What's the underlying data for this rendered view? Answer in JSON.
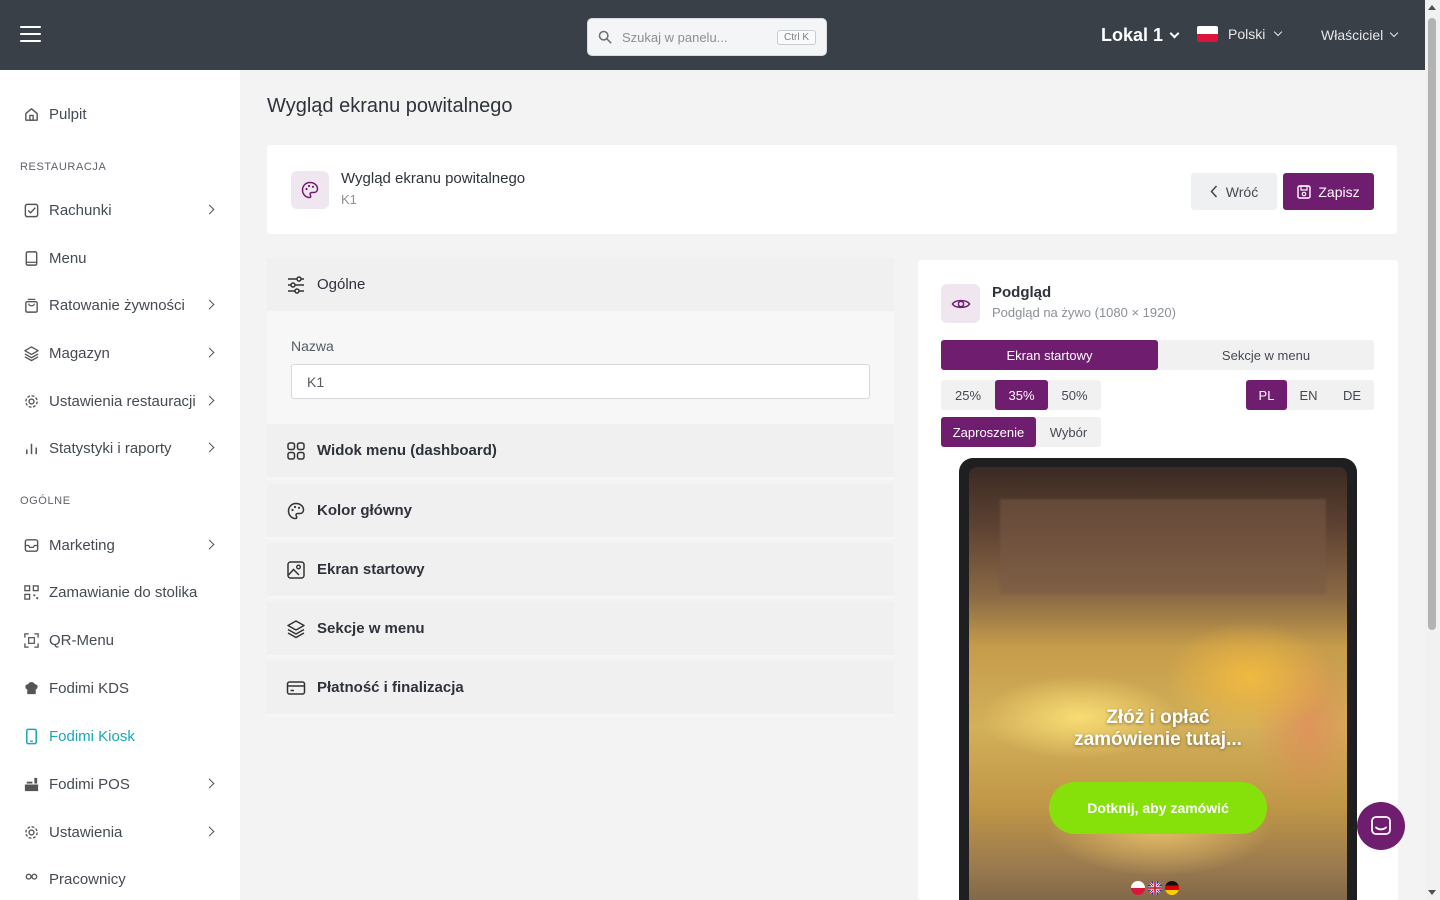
{
  "topbar": {
    "search_placeholder": "Szukaj w panelu...",
    "search_shortcut": "Ctrl K",
    "location": "Lokal 1",
    "language": "Polski",
    "role": "Właściciel"
  },
  "sidebar": {
    "pulpit": "Pulpit",
    "section_restauracja": "RESTAURACJA",
    "rachunki": "Rachunki",
    "menu": "Menu",
    "ratowanie": "Ratowanie żywności",
    "magazyn": "Magazyn",
    "ustawienia_restauracji": "Ustawienia restauracji",
    "statystyki": "Statystyki i raporty",
    "section_ogolne": "OGÓLNE",
    "marketing": "Marketing",
    "zamawianie": "Zamawianie do stolika",
    "qrmenu": "QR-Menu",
    "kds": "Fodimi KDS",
    "kiosk": "Fodimi Kiosk",
    "pos": "Fodimi POS",
    "ustawienia": "Ustawienia",
    "pracownicy": "Pracownicy"
  },
  "page": {
    "title": "Wygląd ekranu powitalnego",
    "card_title": "Wygląd ekranu powitalnego",
    "card_subtitle": "K1",
    "back_label": "Wróć",
    "save_label": "Zapisz"
  },
  "settings": {
    "general": "Ogólne",
    "name_label": "Nazwa",
    "name_value": "K1",
    "dashboard": "Widok menu (dashboard)",
    "color": "Kolor główny",
    "start_screen": "Ekran startowy",
    "sections": "Sekcje w menu",
    "payment": "Płatność i finalizacja"
  },
  "preview": {
    "title": "Podgląd",
    "subtitle": "Podgląd na żywo (1080 × 1920)",
    "tabs": [
      "Ekran startowy",
      "Sekcje w menu"
    ],
    "zoom": [
      "25%",
      "35%",
      "50%"
    ],
    "langs": [
      "PL",
      "EN",
      "DE"
    ],
    "modes": [
      "Zaproszenie",
      "Wybór"
    ],
    "headline_line1": "Złóż i opłać",
    "headline_line2": "zamówienie tutaj...",
    "cta": "Dotknij, aby zamówić"
  },
  "colors": {
    "accent": "#6f1d6f",
    "topbar": "#3a4048",
    "cta": "#86e10b",
    "active_nav": "#1aa7b5"
  }
}
